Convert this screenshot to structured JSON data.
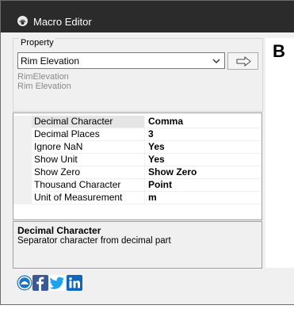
{
  "window": {
    "title": "Macro Editor",
    "app_icon": "app-logo-icon"
  },
  "property": {
    "group_label": "Property",
    "selected": "Rim Elevation",
    "dropdown_icon": "chevron-down-icon",
    "navigate_icon": "arrow-right-icon",
    "internal_name": "RimElevation",
    "display_name": "Rim Elevation"
  },
  "right_panel": {
    "letter": "B"
  },
  "properties_grid": {
    "rows": [
      {
        "name": "Decimal Character",
        "value": "Comma",
        "selected": true
      },
      {
        "name": "Decimal Places",
        "value": "3"
      },
      {
        "name": "Ignore NaN",
        "value": "Yes"
      },
      {
        "name": "Show Unit",
        "value": "Yes"
      },
      {
        "name": "Show Zero",
        "value": "Show Zero"
      },
      {
        "name": "Thousand Character",
        "value": "Point"
      },
      {
        "name": "Unit of Measurement",
        "value": "m"
      }
    ]
  },
  "description": {
    "title": "Decimal Character",
    "text": "Separator character from decimal part"
  },
  "social": [
    {
      "name": "web-icon",
      "color": "#1e74c6"
    },
    {
      "name": "facebook-icon",
      "color": "#3b5998"
    },
    {
      "name": "twitter-icon",
      "color": "#1da1f2"
    },
    {
      "name": "linkedin-icon",
      "color": "#0a66c2"
    }
  ]
}
